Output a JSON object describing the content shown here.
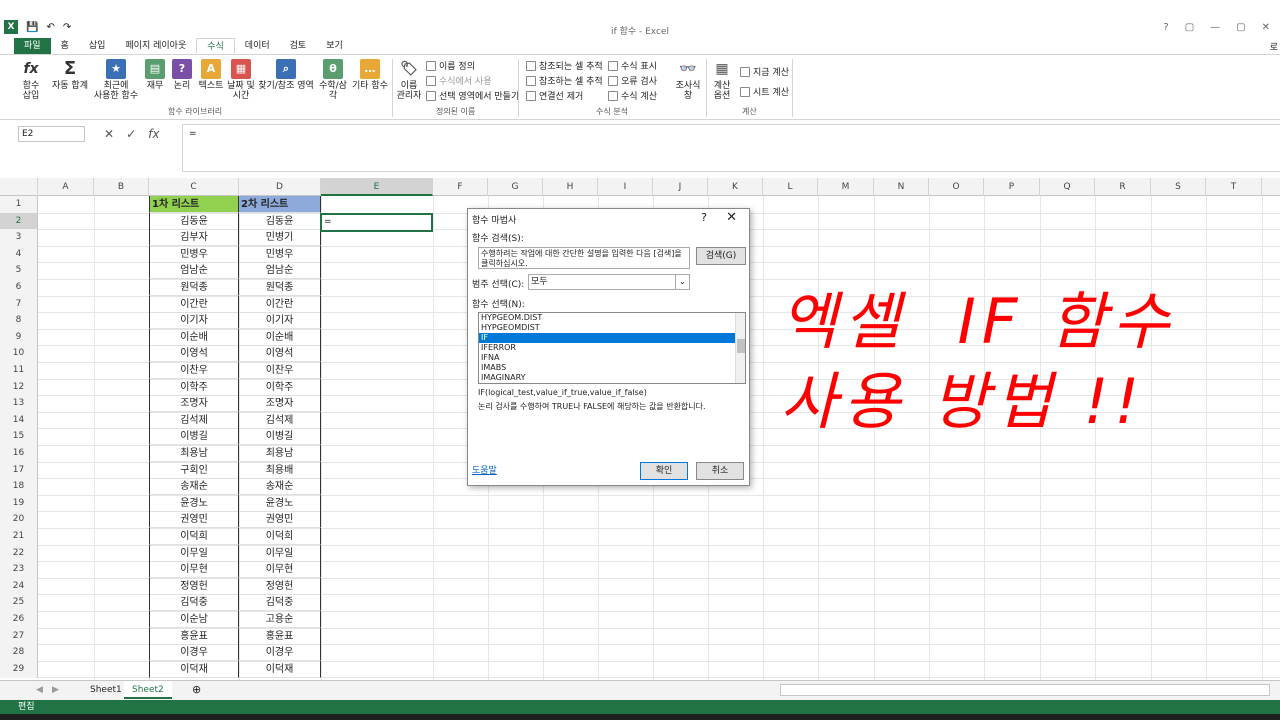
{
  "window": {
    "title": "if 함수 - Excel",
    "user": "로",
    "controls": [
      "?",
      "▢",
      "—",
      "▢",
      "✕"
    ]
  },
  "ribbon_tabs": [
    "파일",
    "홈",
    "삽입",
    "페이지 레이아웃",
    "수식",
    "데이터",
    "검토",
    "보기"
  ],
  "active_tab": "수식",
  "ribbon": {
    "insert_function": "함수\n삽입",
    "autosum": "자동 합계",
    "recent": "최근에\n사용한 함수",
    "financial": "재무",
    "logical": "논리",
    "text": "텍스트",
    "datetime": "날짜 및\n시간",
    "lookup": "찾기/참조 영역",
    "math": "수학/삼각",
    "more": "기타 함수",
    "name_manager": "이름\n관리자",
    "define_name": "이름 정의",
    "use_in_formula": "수식에서 사용",
    "create_from_selection": "선택 영역에서 만들기",
    "trace_precedents": "참조되는 셀 추적",
    "trace_dependents": "참조하는 셀 추적",
    "remove_arrows": "연결선 제거",
    "show_formulas": "수식 표시",
    "error_checking": "오류 검사",
    "evaluate_formula": "수식 계산",
    "watch_window": "조사식\n창",
    "calc_options": "계산\n옵션",
    "calc_now": "지금 계산",
    "calc_sheet": "시트 계산",
    "group_function_library": "함수 라이브러리",
    "group_defined_names": "정의된 이름",
    "group_formula_auditing": "수식 분석",
    "group_calculation": "계산"
  },
  "namebox": "E2",
  "formula_value": "=",
  "columns": [
    "A",
    "B",
    "C",
    "D",
    "E",
    "F",
    "G",
    "H",
    "I",
    "J",
    "K",
    "L",
    "M",
    "N",
    "O",
    "P",
    "Q",
    "R",
    "S",
    "T"
  ],
  "table": {
    "header_c": "1차 리스트",
    "header_d": "2차 리스트",
    "rows": [
      [
        "김동윤",
        "김동윤"
      ],
      [
        "김부자",
        "민병기"
      ],
      [
        "민병우",
        "민병우"
      ],
      [
        "엄남순",
        "엄남순"
      ],
      [
        "원덕종",
        "원덕종"
      ],
      [
        "이간란",
        "이간란"
      ],
      [
        "이기자",
        "이기자"
      ],
      [
        "이순배",
        "이순배"
      ],
      [
        "이영석",
        "이영석"
      ],
      [
        "이찬우",
        "이찬우"
      ],
      [
        "이학주",
        "이학주"
      ],
      [
        "조명자",
        "조명자"
      ],
      [
        "김석제",
        "김석제"
      ],
      [
        "이병길",
        "이병길"
      ],
      [
        "최용남",
        "최용남"
      ],
      [
        "구회인",
        "최용배"
      ],
      [
        "송재순",
        "송재순"
      ],
      [
        "윤경노",
        "윤경노"
      ],
      [
        "권영민",
        "권영민"
      ],
      [
        "이덕희",
        "이덕희"
      ],
      [
        "이무일",
        "이무일"
      ],
      [
        "이무현",
        "이무현"
      ],
      [
        "정영헌",
        "정영헌"
      ],
      [
        "김덕중",
        "김덕중"
      ],
      [
        "이순남",
        "고용순"
      ],
      [
        "홍윤표",
        "홍윤표"
      ],
      [
        "이경우",
        "이경우"
      ],
      [
        "이덕재",
        "이덕재"
      ]
    ]
  },
  "active_cell_value": "=",
  "sheets": [
    "Sheet1",
    "Sheet2"
  ],
  "active_sheet": "Sheet2",
  "status": "편집",
  "dialog": {
    "title": "함수 마법사",
    "help_q": "?",
    "close": "✕",
    "search_label": "함수 검색(S):",
    "search_text": "수행하려는 작업에 대한 간단한 설명을 입력한 다음 [검색]을 클릭하십시오.",
    "search_button": "검색(G)",
    "category_label": "범주 선택(C):",
    "category_value": "모두",
    "function_label": "함수 선택(N):",
    "functions": [
      "HYPGEOM.DIST",
      "HYPGEOMDIST",
      "IF",
      "IFERROR",
      "IFNA",
      "IMABS",
      "IMAGINARY"
    ],
    "selected_function": "IF",
    "syntax": "IF(logical_test,value_if_true,value_if_false)",
    "description": "논리 검사를 수행하여 TRUE나 FALSE에 해당하는 값을 반환합니다.",
    "help_link": "도움말",
    "ok": "확인",
    "cancel": "취소"
  },
  "annotation": {
    "line1": "엑셀  IF 함수",
    "line2": "사용 방법 !!",
    "color": "#ff0000"
  },
  "colors": {
    "excel_green": "#217346",
    "header_c": "#92d050",
    "header_d": "#8eaadb",
    "selection": "#0078d7"
  }
}
